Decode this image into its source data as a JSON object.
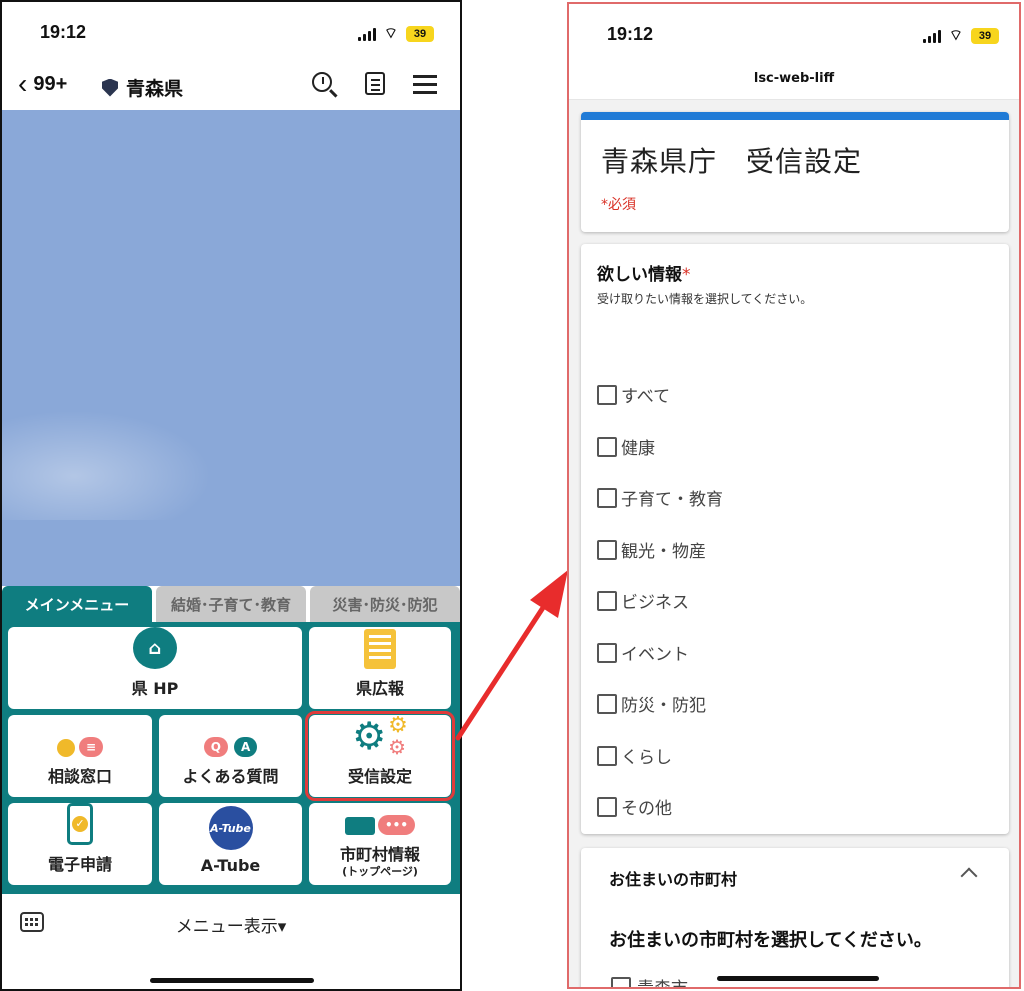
{
  "left": {
    "status": {
      "time": "19:12",
      "battery": "39"
    },
    "header": {
      "back_count": "99+",
      "account_name": "青森県"
    },
    "tabs": [
      {
        "label": "メインメニュー",
        "active": true
      },
      {
        "label": "結婚･子育て･教育",
        "active": false
      },
      {
        "label": "災害･防災･防犯",
        "active": false
      }
    ],
    "menu": {
      "pref_hp": "県 HP",
      "pref_pr": "県広報",
      "consult": "相談窓口",
      "faq": "よくある質問",
      "faq_q": "Q",
      "faq_a": "A",
      "receive": "受信設定",
      "e_apply": "電子申請",
      "atube": "A-Tube",
      "atube_logo": "A-Tube",
      "city_info": "市町村情報",
      "city_info_sub": "(トップページ)"
    },
    "bottom": {
      "menu_toggle": "メニュー表示▾"
    }
  },
  "right": {
    "status": {
      "time": "19:12",
      "battery": "39"
    },
    "liff_title": "lsc-web-liff",
    "form": {
      "title": "青森県庁　受信設定",
      "required_note": "*必須",
      "question": {
        "title": "欲しい情報",
        "required_mark": "*",
        "description": "受け取りたい情報を選択してください。",
        "options": [
          "すべて",
          "健康",
          "子育て・教育",
          "観光・物産",
          "ビジネス",
          "イベント",
          "防災・防犯",
          "くらし",
          "その他"
        ]
      },
      "city_section": {
        "title": "お住まいの市町村",
        "question": "お住まいの市町村を選択してください。",
        "first_option": "青森市"
      }
    }
  },
  "colors": {
    "teal": "#0f7d80",
    "chat_bg": "#8aa8d8",
    "form_accent": "#1f7ad6",
    "required": "#d93025",
    "arrow": "#e82c2c"
  }
}
